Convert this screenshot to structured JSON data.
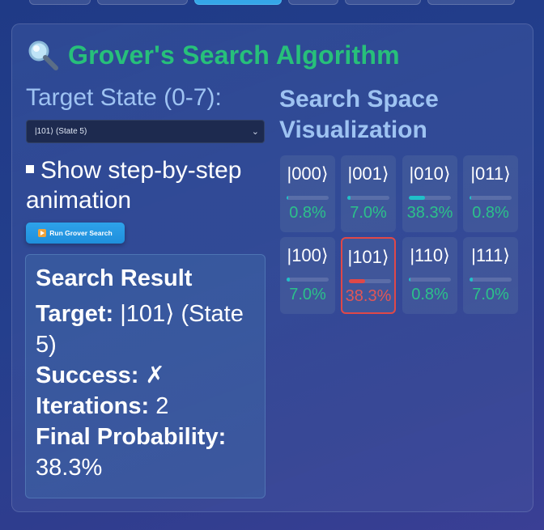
{
  "title": {
    "icon": "magnifying-glass-icon",
    "text": "Grover's Search Algorithm"
  },
  "target": {
    "label": "Target State (0-7):",
    "selected": "|101⟩ (State 5)"
  },
  "animation": {
    "label": "Show step-by-step animation",
    "checked": true
  },
  "run_button": {
    "label": "Run Grover Search",
    "icon": "play-icon"
  },
  "result": {
    "heading": "Search Result",
    "target_key": "Target:",
    "target_value": "|101⟩ (State 5)",
    "success_key": "Success:",
    "success_value": "✗",
    "iterations_key": "Iterations:",
    "iterations_value": "2",
    "prob_key": "Final Probability:",
    "prob_value": "38.3%"
  },
  "space": {
    "title": "Search Space Visualization",
    "states": [
      {
        "ket": "|000⟩",
        "pct": "0.8%",
        "prob": 0.008,
        "highlight": false
      },
      {
        "ket": "|001⟩",
        "pct": "7.0%",
        "prob": 0.07,
        "highlight": false
      },
      {
        "ket": "|010⟩",
        "pct": "38.3%",
        "prob": 0.383,
        "highlight": false
      },
      {
        "ket": "|011⟩",
        "pct": "0.8%",
        "prob": 0.008,
        "highlight": false
      },
      {
        "ket": "|100⟩",
        "pct": "7.0%",
        "prob": 0.07,
        "highlight": false
      },
      {
        "ket": "|101⟩",
        "pct": "38.3%",
        "prob": 0.383,
        "highlight": true
      },
      {
        "ket": "|110⟩",
        "pct": "0.8%",
        "prob": 0.008,
        "highlight": false
      },
      {
        "ket": "|111⟩",
        "pct": "7.0%",
        "prob": 0.07,
        "highlight": false
      }
    ]
  },
  "colors": {
    "title": "#27c07a",
    "label": "#9ec3f2",
    "percent": "#2cc18a",
    "highlight": "#e04848",
    "bar": "#20c0c8"
  }
}
